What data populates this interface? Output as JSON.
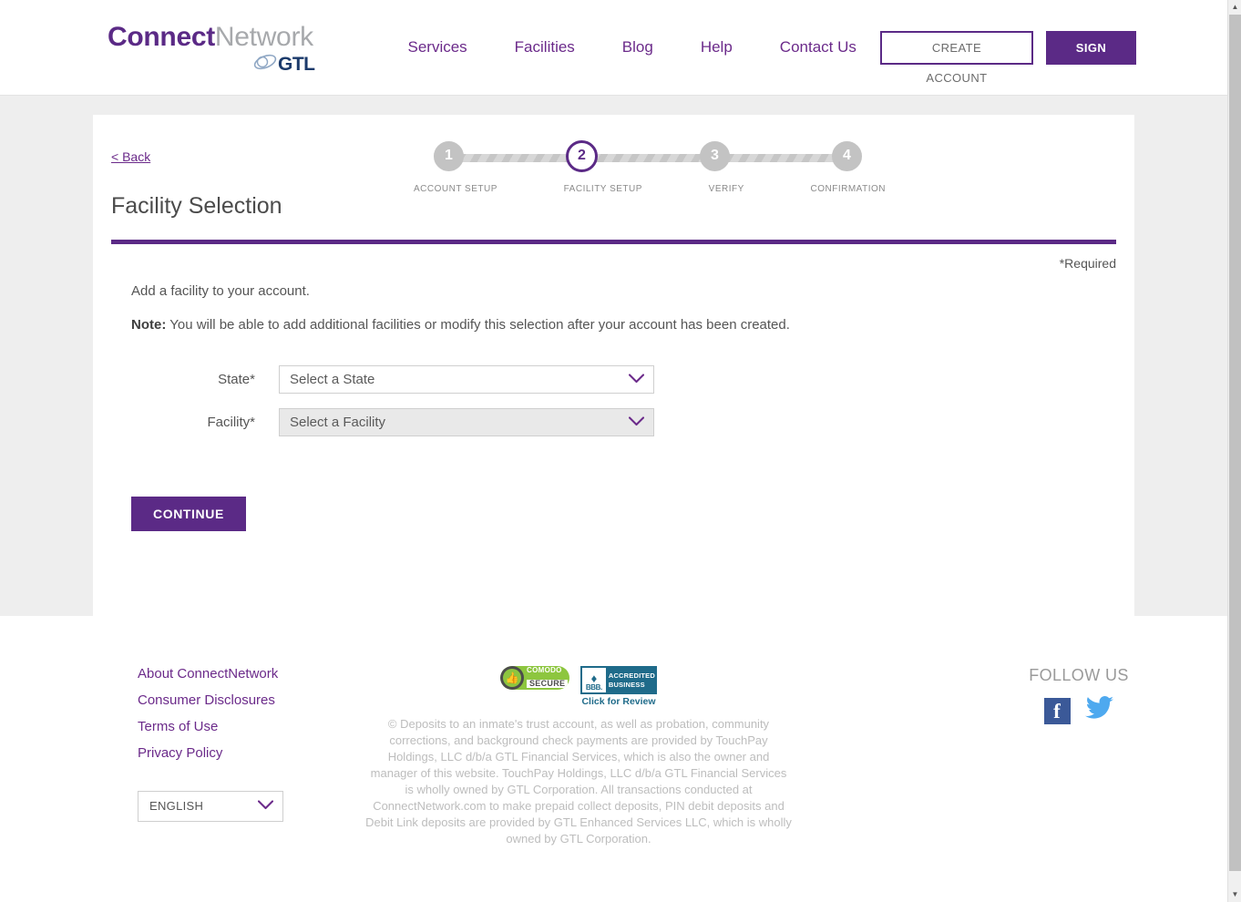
{
  "header": {
    "logo": {
      "connect": "Connect",
      "network": "Network",
      "gtl": "GTL"
    },
    "nav": [
      {
        "label": "Services"
      },
      {
        "label": "Facilities"
      },
      {
        "label": "Blog"
      },
      {
        "label": "Help"
      },
      {
        "label": "Contact Us"
      }
    ],
    "create_account_label": "CREATE ACCOUNT",
    "sign_in_label": "SIGN IN"
  },
  "wizard": {
    "back_label": "< Back",
    "steps": [
      {
        "number": "1",
        "label": "ACCOUNT SETUP",
        "state": "done"
      },
      {
        "number": "2",
        "label": "FACILITY SETUP",
        "state": "current"
      },
      {
        "number": "3",
        "label": "VERIFY",
        "state": "done"
      },
      {
        "number": "4",
        "label": "CONFIRMATION",
        "state": "done"
      }
    ],
    "title": "Facility Selection",
    "required_note": "*Required",
    "intro": "Add a facility to your account.",
    "note_label": "Note:",
    "note_text": " You will be able to add additional facilities or modify this selection after your account has been created.",
    "fields": {
      "state": {
        "label": "State",
        "required_mark": "*",
        "value": "Select a State"
      },
      "facility": {
        "label": "Facility",
        "required_mark": "*",
        "value": "Select a Facility"
      }
    },
    "continue_label": "CONTINUE"
  },
  "footer": {
    "links": [
      {
        "label": "About ConnectNetwork"
      },
      {
        "label": "Consumer Disclosures"
      },
      {
        "label": "Terms of Use"
      },
      {
        "label": "Privacy Policy"
      }
    ],
    "language": "ENGLISH",
    "badges": {
      "comodo_line1": "COMODO",
      "comodo_line2": "SECURE",
      "bbb_mark": "BBB.",
      "bbb_line1": "ACCREDITED",
      "bbb_line2": "BUSINESS",
      "bbb_review": "Click for Review"
    },
    "copyright": "© Deposits to an inmate's trust account, as well as probation, community corrections, and background check payments are provided by TouchPay Holdings, LLC d/b/a GTL Financial Services, which is also the owner and manager of this website. TouchPay Holdings, LLC d/b/a GTL Financial Services is wholly owned by GTL Corporation. All transactions conducted at ConnectNetwork.com to make prepaid collect deposits, PIN debit deposits and Debit Link deposits are provided by GTL Enhanced Services LLC, which is wholly owned by GTL Corporation.",
    "follow_us": "FOLLOW US",
    "facebook_glyph": "f"
  },
  "colors": {
    "brand_purple": "#5b2a86",
    "link_purple": "#6b2a8a",
    "gtl_navy": "#1b3a6b",
    "facebook_blue": "#3b5998",
    "twitter_blue": "#4ea9ef",
    "comodo_green": "#8dc63f",
    "bbb_teal": "#1f6b8a"
  }
}
